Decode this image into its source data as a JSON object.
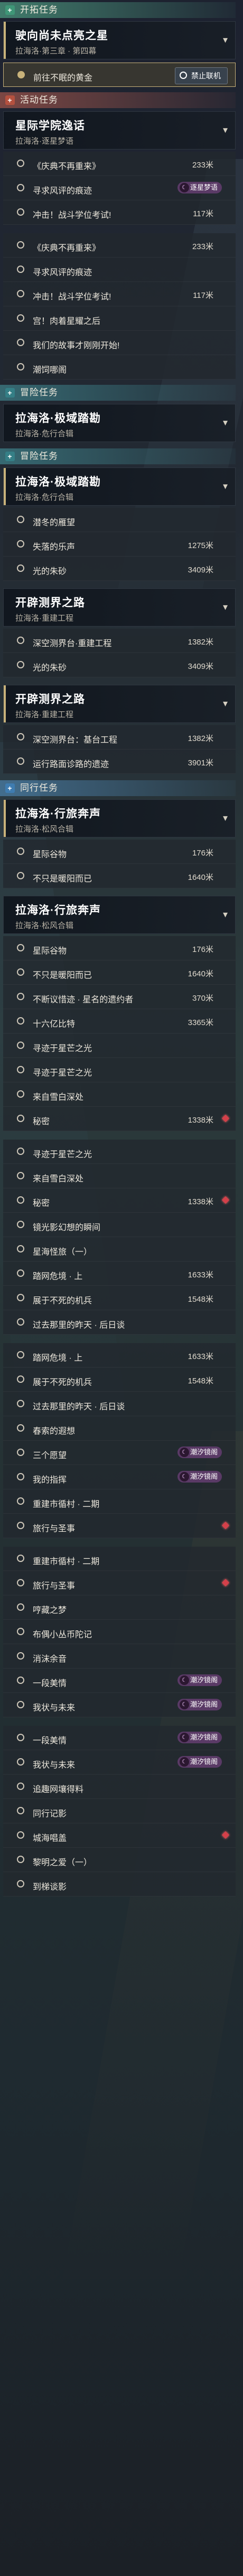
{
  "colors": {
    "accent": "#c8b27a",
    "section_trailblaze": "#5ec59c",
    "section_event": "#d86a56",
    "section_adventure": "#4aa8b0",
    "section_companion": "#5aa0d8",
    "marker_red": "#d4404a",
    "tag_purple": "#5a3a66"
  },
  "icons": {
    "section_marker": "plus-icon",
    "chevron": "chevron-down-icon",
    "step_ring": "circle-icon",
    "waypoint": "diamond-marker-icon",
    "tag": "moon-icon",
    "button": "stop-icon"
  },
  "sections": {
    "trailblaze": "开拓任务",
    "event": "活动任务",
    "adventure": "冒险任务",
    "adventure_2": "冒险任务",
    "companion": "同行任务"
  },
  "quests": {
    "q1": {
      "title": "驶向尚未点亮之星",
      "sub": "拉海洛·第三章 · 第四幕"
    },
    "q2": {
      "title": "星际学院逸话",
      "sub": "拉海洛·逐星梦语"
    },
    "q3": {
      "title": "拉海洛·极域踏勘",
      "sub": "拉海洛·危行合辑"
    },
    "q4": {
      "title": "拉海洛·极域踏勘",
      "sub": "拉海洛·危行合辑"
    },
    "q5": {
      "title": "开辟测界之路",
      "sub": "拉海洛·重建工程"
    },
    "q6": {
      "title": "开辟测界之路",
      "sub": "拉海洛·重建工程"
    },
    "q7": {
      "title": "拉海洛·行旅奔声",
      "sub": "拉海洛·松风合辑"
    },
    "q8": {
      "title": "拉海洛·行旅奔声",
      "sub": "拉海洛·松风合辑"
    }
  },
  "button": {
    "label": "禁止联机"
  },
  "tags": {
    "dream": "逐星梦语",
    "moon": "潮汐镜阁"
  },
  "steps": [
    {
      "text": "前往不眠的黄金",
      "dist": ""
    },
    {
      "text": "《庆典不再重来》",
      "dist": "233米"
    },
    {
      "text": "寻求风评的痕迹",
      "dist": ""
    },
    {
      "text": "冲击！战斗学位考试!",
      "dist": "117米"
    },
    {
      "text": "《庆典不再重来》",
      "dist": "233米"
    },
    {
      "text": "寻求风评的痕迹",
      "dist": ""
    },
    {
      "text": "冲击！战斗学位考试!",
      "dist": "117米"
    },
    {
      "text": "宫！肉着星耀之后",
      "dist": ""
    },
    {
      "text": "我们的故事才刚刚开始!",
      "dist": ""
    },
    {
      "text": "潮饲哪阁",
      "dist": ""
    },
    {
      "text": "潜冬的雁望",
      "dist": ""
    },
    {
      "text": "失落的乐声",
      "dist": "1275米"
    },
    {
      "text": "光的朱砂",
      "dist": "3409米"
    },
    {
      "text": "深空测界台·重建工程",
      "dist": "1382米"
    },
    {
      "text": "光的朱砂",
      "dist": "3409米"
    },
    {
      "text": "深空测界台：基台工程",
      "dist": "1382米"
    },
    {
      "text": "运行路面诊路的遗迹",
      "dist": "3901米"
    },
    {
      "text": "星际谷物",
      "dist": "176米"
    },
    {
      "text": "不只是暖阳而已",
      "dist": "1640米"
    },
    {
      "text": "星际谷物",
      "dist": "176米"
    },
    {
      "text": "不只是暖阳而已",
      "dist": "1640米"
    },
    {
      "text": "不断议惜迹 · 星名的遗约者",
      "dist": "370米"
    },
    {
      "text": "十六亿比特",
      "dist": "3365米"
    },
    {
      "text": "寻迹于星芒之光",
      "dist": ""
    },
    {
      "text": "寻迹于星芒之光",
      "dist": ""
    },
    {
      "text": "来自雪白深处",
      "dist": ""
    },
    {
      "text": "秘密",
      "dist": "1338米"
    },
    {
      "text": "寻迹于星芒之光",
      "dist": ""
    },
    {
      "text": "来自雪白深处",
      "dist": ""
    },
    {
      "text": "秘密",
      "dist": "1338米"
    },
    {
      "text": "镜光影幻想的瞬间",
      "dist": ""
    },
    {
      "text": "星海怪旅（一）",
      "dist": ""
    },
    {
      "text": "踏网危境 · 上",
      "dist": "1633米"
    },
    {
      "text": "展于不死的机兵",
      "dist": "1548米"
    },
    {
      "text": "过去那里的昨天 · 后日谈",
      "dist": ""
    },
    {
      "text": "踏网危境 · 上",
      "dist": "1633米"
    },
    {
      "text": "展于不死的机兵",
      "dist": "1548米"
    },
    {
      "text": "过去那里的昨天 · 后日谈",
      "dist": ""
    },
    {
      "text": "春索的遐想",
      "dist": ""
    },
    {
      "text": "三个愿望",
      "dist": ""
    },
    {
      "text": "我的指挥",
      "dist": ""
    },
    {
      "text": "重建市循村 · 二期",
      "dist": ""
    },
    {
      "text": "旅行与圣事",
      "dist": ""
    },
    {
      "text": "重建市循村 · 二期",
      "dist": ""
    },
    {
      "text": "旅行与圣事",
      "dist": ""
    },
    {
      "text": "哼藏之梦",
      "dist": ""
    },
    {
      "text": "布偶小丛币陀记",
      "dist": ""
    },
    {
      "text": "消沫余音",
      "dist": ""
    },
    {
      "text": "一段美情",
      "dist": ""
    },
    {
      "text": "我状与未来",
      "dist": ""
    },
    {
      "text": "一段美情",
      "dist": ""
    },
    {
      "text": "我状与未来",
      "dist": ""
    },
    {
      "text": "追趣网壤得料",
      "dist": ""
    },
    {
      "text": "同行记影",
      "dist": ""
    },
    {
      "text": "城海唱盖",
      "dist": ""
    },
    {
      "text": "黎明之爱（一）",
      "dist": ""
    },
    {
      "text": "到梯谈影",
      "dist": ""
    }
  ]
}
